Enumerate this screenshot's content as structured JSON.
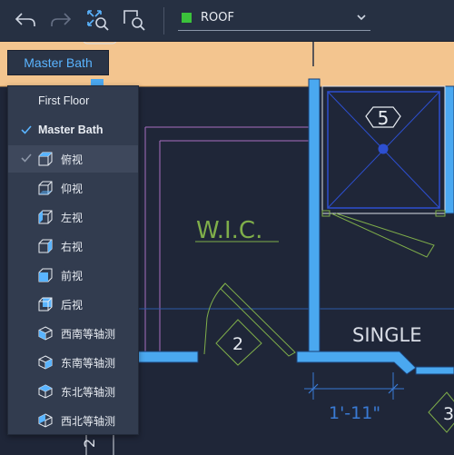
{
  "toolbar": {
    "undo_icon": "undo-icon",
    "redo_icon": "redo-icon",
    "zoom_extents_icon": "zoom-extents-icon",
    "zoom_window_icon": "zoom-window-icon",
    "layer": {
      "name": "ROOF",
      "swatch_color": "#3bc23b"
    }
  },
  "view_chip": {
    "label": "Master Bath",
    "color": "#5ab4ff"
  },
  "menu": {
    "items": [
      {
        "label": "First Floor",
        "checked": false
      },
      {
        "label": "Master Bath",
        "checked": true
      }
    ],
    "views": [
      {
        "label": "俯视",
        "icon": "top-view-icon",
        "selected": true
      },
      {
        "label": "仰视",
        "icon": "bottom-view-icon"
      },
      {
        "label": "左视",
        "icon": "left-view-icon"
      },
      {
        "label": "右视",
        "icon": "right-view-icon"
      },
      {
        "label": "前视",
        "icon": "front-view-icon"
      },
      {
        "label": "后视",
        "icon": "back-view-icon"
      },
      {
        "label": "西南等轴测",
        "icon": "sw-iso-icon"
      },
      {
        "label": "东南等轴测",
        "icon": "se-iso-icon"
      },
      {
        "label": "东北等轴测",
        "icon": "ne-iso-icon"
      },
      {
        "label": "西北等轴测",
        "icon": "nw-iso-icon"
      }
    ]
  },
  "drawing": {
    "room_label": "W.I.C.",
    "room_label_color": "#7fae4a",
    "tag_5": "5",
    "tag_2": "2",
    "tag_3": "3",
    "single_label": "SINGLE",
    "dimension": "1'-11\"",
    "dimension_color": "#3a7bd5",
    "side_number": "2",
    "wall_color": "#4aa8f0",
    "band_color": "#f3c58f"
  }
}
